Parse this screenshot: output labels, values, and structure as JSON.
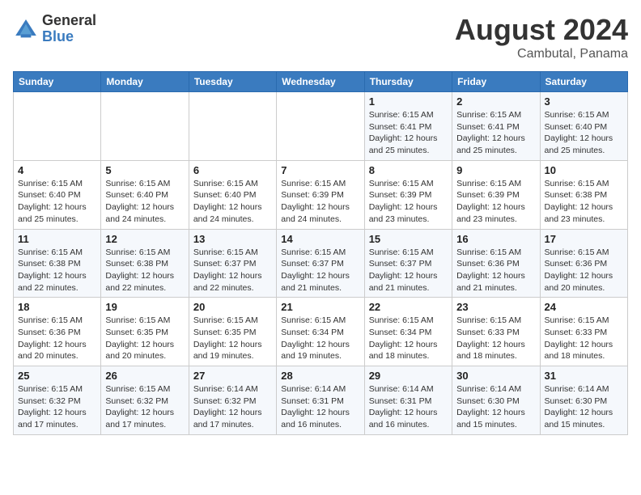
{
  "logo": {
    "general": "General",
    "blue": "Blue"
  },
  "title": "August 2024",
  "location": "Cambutal, Panama",
  "days_of_week": [
    "Sunday",
    "Monday",
    "Tuesday",
    "Wednesday",
    "Thursday",
    "Friday",
    "Saturday"
  ],
  "weeks": [
    [
      {
        "day": "",
        "info": ""
      },
      {
        "day": "",
        "info": ""
      },
      {
        "day": "",
        "info": ""
      },
      {
        "day": "",
        "info": ""
      },
      {
        "day": "1",
        "info": "Sunrise: 6:15 AM\nSunset: 6:41 PM\nDaylight: 12 hours\nand 25 minutes."
      },
      {
        "day": "2",
        "info": "Sunrise: 6:15 AM\nSunset: 6:41 PM\nDaylight: 12 hours\nand 25 minutes."
      },
      {
        "day": "3",
        "info": "Sunrise: 6:15 AM\nSunset: 6:40 PM\nDaylight: 12 hours\nand 25 minutes."
      }
    ],
    [
      {
        "day": "4",
        "info": "Sunrise: 6:15 AM\nSunset: 6:40 PM\nDaylight: 12 hours\nand 25 minutes."
      },
      {
        "day": "5",
        "info": "Sunrise: 6:15 AM\nSunset: 6:40 PM\nDaylight: 12 hours\nand 24 minutes."
      },
      {
        "day": "6",
        "info": "Sunrise: 6:15 AM\nSunset: 6:40 PM\nDaylight: 12 hours\nand 24 minutes."
      },
      {
        "day": "7",
        "info": "Sunrise: 6:15 AM\nSunset: 6:39 PM\nDaylight: 12 hours\nand 24 minutes."
      },
      {
        "day": "8",
        "info": "Sunrise: 6:15 AM\nSunset: 6:39 PM\nDaylight: 12 hours\nand 23 minutes."
      },
      {
        "day": "9",
        "info": "Sunrise: 6:15 AM\nSunset: 6:39 PM\nDaylight: 12 hours\nand 23 minutes."
      },
      {
        "day": "10",
        "info": "Sunrise: 6:15 AM\nSunset: 6:38 PM\nDaylight: 12 hours\nand 23 minutes."
      }
    ],
    [
      {
        "day": "11",
        "info": "Sunrise: 6:15 AM\nSunset: 6:38 PM\nDaylight: 12 hours\nand 22 minutes."
      },
      {
        "day": "12",
        "info": "Sunrise: 6:15 AM\nSunset: 6:38 PM\nDaylight: 12 hours\nand 22 minutes."
      },
      {
        "day": "13",
        "info": "Sunrise: 6:15 AM\nSunset: 6:37 PM\nDaylight: 12 hours\nand 22 minutes."
      },
      {
        "day": "14",
        "info": "Sunrise: 6:15 AM\nSunset: 6:37 PM\nDaylight: 12 hours\nand 21 minutes."
      },
      {
        "day": "15",
        "info": "Sunrise: 6:15 AM\nSunset: 6:37 PM\nDaylight: 12 hours\nand 21 minutes."
      },
      {
        "day": "16",
        "info": "Sunrise: 6:15 AM\nSunset: 6:36 PM\nDaylight: 12 hours\nand 21 minutes."
      },
      {
        "day": "17",
        "info": "Sunrise: 6:15 AM\nSunset: 6:36 PM\nDaylight: 12 hours\nand 20 minutes."
      }
    ],
    [
      {
        "day": "18",
        "info": "Sunrise: 6:15 AM\nSunset: 6:36 PM\nDaylight: 12 hours\nand 20 minutes."
      },
      {
        "day": "19",
        "info": "Sunrise: 6:15 AM\nSunset: 6:35 PM\nDaylight: 12 hours\nand 20 minutes."
      },
      {
        "day": "20",
        "info": "Sunrise: 6:15 AM\nSunset: 6:35 PM\nDaylight: 12 hours\nand 19 minutes."
      },
      {
        "day": "21",
        "info": "Sunrise: 6:15 AM\nSunset: 6:34 PM\nDaylight: 12 hours\nand 19 minutes."
      },
      {
        "day": "22",
        "info": "Sunrise: 6:15 AM\nSunset: 6:34 PM\nDaylight: 12 hours\nand 18 minutes."
      },
      {
        "day": "23",
        "info": "Sunrise: 6:15 AM\nSunset: 6:33 PM\nDaylight: 12 hours\nand 18 minutes."
      },
      {
        "day": "24",
        "info": "Sunrise: 6:15 AM\nSunset: 6:33 PM\nDaylight: 12 hours\nand 18 minutes."
      }
    ],
    [
      {
        "day": "25",
        "info": "Sunrise: 6:15 AM\nSunset: 6:32 PM\nDaylight: 12 hours\nand 17 minutes."
      },
      {
        "day": "26",
        "info": "Sunrise: 6:15 AM\nSunset: 6:32 PM\nDaylight: 12 hours\nand 17 minutes."
      },
      {
        "day": "27",
        "info": "Sunrise: 6:14 AM\nSunset: 6:32 PM\nDaylight: 12 hours\nand 17 minutes."
      },
      {
        "day": "28",
        "info": "Sunrise: 6:14 AM\nSunset: 6:31 PM\nDaylight: 12 hours\nand 16 minutes."
      },
      {
        "day": "29",
        "info": "Sunrise: 6:14 AM\nSunset: 6:31 PM\nDaylight: 12 hours\nand 16 minutes."
      },
      {
        "day": "30",
        "info": "Sunrise: 6:14 AM\nSunset: 6:30 PM\nDaylight: 12 hours\nand 15 minutes."
      },
      {
        "day": "31",
        "info": "Sunrise: 6:14 AM\nSunset: 6:30 PM\nDaylight: 12 hours\nand 15 minutes."
      }
    ]
  ]
}
